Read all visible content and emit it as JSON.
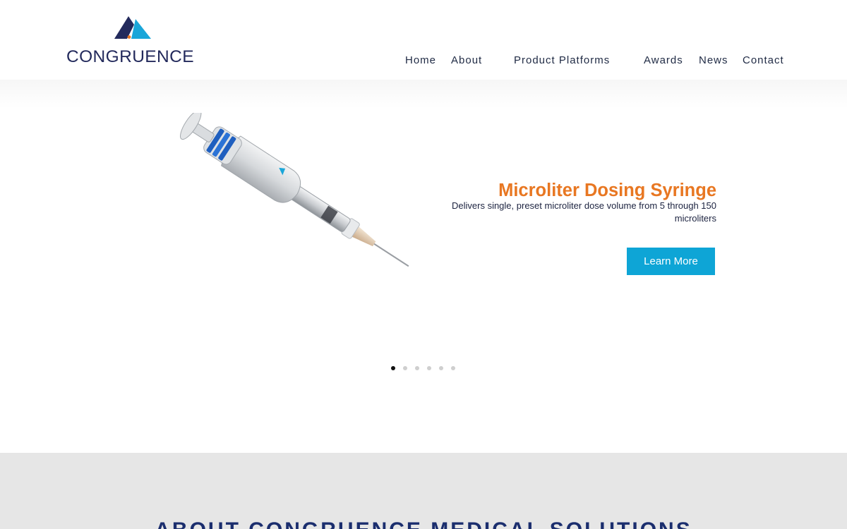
{
  "brand": {
    "name": "CONGRUENCE",
    "colors": {
      "navy": "#232a5c",
      "teal": "#1aa6d9",
      "orange": "#e87722",
      "link": "#1f2a44"
    }
  },
  "nav": {
    "items": [
      {
        "label": "Home"
      },
      {
        "label": "About"
      },
      {
        "label": "Product Platforms"
      },
      {
        "label": "Awards"
      },
      {
        "label": "News"
      },
      {
        "label": "Contact"
      }
    ]
  },
  "slider": {
    "image_icon": "dosing-syringe-image",
    "title": "Microliter Dosing Syringe",
    "description": "Delivers single, preset microliter dose volume from 5 through 150 microliters",
    "button_label": "Learn More",
    "button_color": "#0ea5d6",
    "slide_count": 6,
    "active_slide": 1
  },
  "about": {
    "heading": "ABOUT CONGRUENCE MEDICAL SOLUTIONS",
    "background": "#e6e6e6"
  }
}
